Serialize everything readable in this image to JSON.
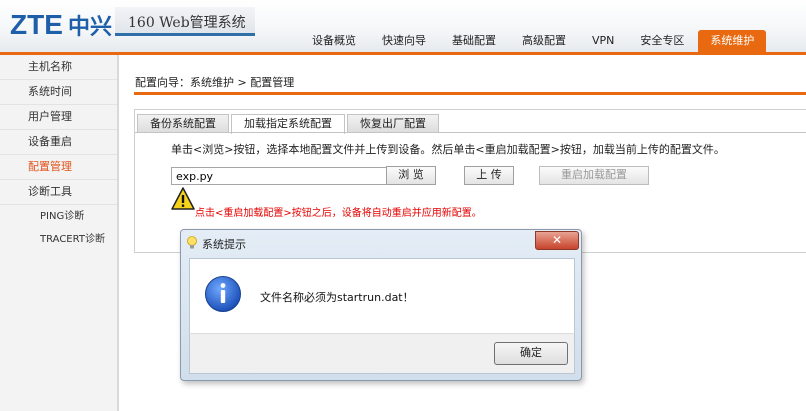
{
  "header": {
    "logo_text": "ZTE中兴",
    "subtitle": "160 Web管理系统",
    "nav": [
      "设备概览",
      "快速向导",
      "基础配置",
      "高级配置",
      "VPN",
      "安全专区",
      "系统维护"
    ],
    "active_nav": "系统维护"
  },
  "sidebar": {
    "items": [
      "主机名称",
      "系统时间",
      "用户管理",
      "设备重启",
      "配置管理",
      "诊断工具"
    ],
    "active_item": "配置管理",
    "subitems": [
      "PING诊断",
      "TRACERT诊断"
    ]
  },
  "breadcrumb": "配置向导：系统维护 > 配置管理",
  "tabs": [
    "备份系统配置",
    "加载指定系统配置",
    "恢复出厂配置"
  ],
  "active_tab": "加载指定系统配置",
  "instruction": "单击<浏览>按钮，选择本地配置文件并上传到设备。然后单击<重启加载配置>按钮，加载当前上传的配置文件。",
  "file_input_value": "exp.py",
  "buttons": {
    "browse": "浏 览",
    "upload": "上 传",
    "reboot": "重启加载配置"
  },
  "warning": "点击<重启加载配置>按钮之后，设备将自动重启并应用新配置。",
  "dialog": {
    "title": "系统提示",
    "close": "✕",
    "message": "文件名称必须为startrun.dat！",
    "ok": "确定"
  },
  "colors": {
    "accent_orange": "#e8690f",
    "warning_red": "#e60000",
    "active_menu": "#e2531a",
    "logo_blue": "#1e5fa9"
  },
  "icons": [
    "lightbulb-icon",
    "info-icon",
    "warning-icon",
    "close-icon"
  ]
}
